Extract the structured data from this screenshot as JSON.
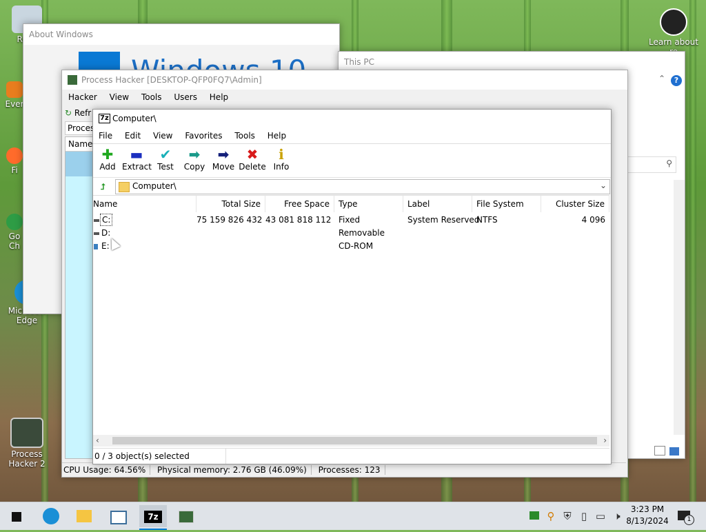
{
  "desktop": {
    "icons": [
      {
        "label": "Recy",
        "name": "recycle-bin-icon"
      },
      {
        "label": "Ever",
        "name": "everything-icon"
      },
      {
        "label": "Fi",
        "name": "firefox-icon"
      },
      {
        "label": "Go Ch",
        "name": "chrome-icon"
      },
      {
        "label": "Microsoft Edge",
        "name": "edge-icon"
      },
      {
        "label": "Process Hacker 2",
        "name": "process-hacker-desktop-icon"
      },
      {
        "label": "Learn about re",
        "name": "learn-about-picture-icon"
      }
    ]
  },
  "about_windows": {
    "title": "About Windows",
    "logo_text": "Windows 10"
  },
  "this_pc": {
    "title": "This PC"
  },
  "process_hacker": {
    "title": "Process Hacker [DESKTOP-QFP0FQ7\\Admin]",
    "menu": [
      "Hacker",
      "View",
      "Tools",
      "Users",
      "Help"
    ],
    "toolbar_refresh": "Refr",
    "tab": "Process",
    "col_name": "Name",
    "status": {
      "cpu": "CPU Usage: 64.56%",
      "memory": "Physical memory: 2.76 GB (46.09%)",
      "processes": "Processes: 123"
    }
  },
  "sevenzip": {
    "title": "Computer\\",
    "app_icon_text": "7z",
    "menu": [
      "File",
      "Edit",
      "View",
      "Favorites",
      "Tools",
      "Help"
    ],
    "toolbar": [
      {
        "label": "Add",
        "icon": "add-icon",
        "glyph": "✚",
        "color": "#1fa81f"
      },
      {
        "label": "Extract",
        "icon": "extract-icon",
        "glyph": "▬",
        "color": "#1b2fbf"
      },
      {
        "label": "Test",
        "icon": "test-icon",
        "glyph": "✔",
        "color": "#19b0b8"
      },
      {
        "label": "Copy",
        "icon": "copy-icon",
        "glyph": "➡",
        "color": "#1a9a8a"
      },
      {
        "label": "Move",
        "icon": "move-icon",
        "glyph": "➡",
        "color": "#14207a"
      },
      {
        "label": "Delete",
        "icon": "delete-icon",
        "glyph": "✖",
        "color": "#d81b1b"
      },
      {
        "label": "Info",
        "icon": "info-icon",
        "glyph": "ℹ",
        "color": "#c9a100"
      }
    ],
    "address": "Computer\\",
    "columns": [
      "Name",
      "Total Size",
      "Free Space",
      "Type",
      "Label",
      "File System",
      "Cluster Size"
    ],
    "rows": [
      {
        "name": "C:",
        "total": "75 159 826 432",
        "free": "43 081 818 112",
        "type": "Fixed",
        "label": "System Reserved",
        "fs": "NTFS",
        "cluster": "4 096"
      },
      {
        "name": "D:",
        "total": "",
        "free": "",
        "type": "Removable",
        "label": "",
        "fs": "",
        "cluster": ""
      },
      {
        "name": "E:",
        "total": "",
        "free": "",
        "type": "CD-ROM",
        "label": "",
        "fs": "",
        "cluster": ""
      }
    ],
    "status": "0 / 3 object(s) selected"
  },
  "taskbar": {
    "time": "3:23 PM",
    "date": "8/13/2024",
    "notifications": "1"
  },
  "colors": {
    "accent": "#0078d7",
    "taskbar": "#dfe3e8",
    "ph_tree_bg": "#c9f5ff"
  }
}
